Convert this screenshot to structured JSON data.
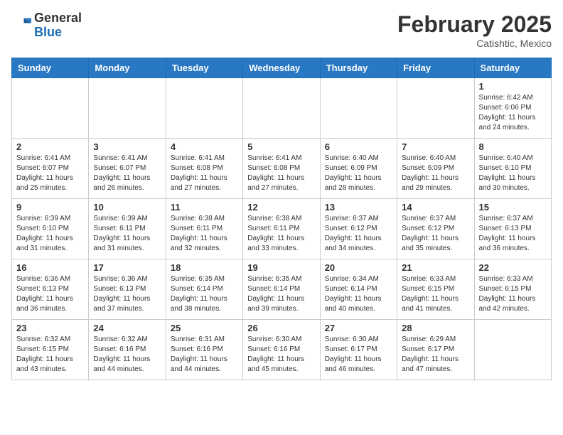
{
  "header": {
    "logo_general": "General",
    "logo_blue": "Blue",
    "month_year": "February 2025",
    "location": "Catishtic, Mexico"
  },
  "weekdays": [
    "Sunday",
    "Monday",
    "Tuesday",
    "Wednesday",
    "Thursday",
    "Friday",
    "Saturday"
  ],
  "weeks": [
    [
      {
        "day": "",
        "info": ""
      },
      {
        "day": "",
        "info": ""
      },
      {
        "day": "",
        "info": ""
      },
      {
        "day": "",
        "info": ""
      },
      {
        "day": "",
        "info": ""
      },
      {
        "day": "",
        "info": ""
      },
      {
        "day": "1",
        "info": "Sunrise: 6:42 AM\nSunset: 6:06 PM\nDaylight: 11 hours\nand 24 minutes."
      }
    ],
    [
      {
        "day": "2",
        "info": "Sunrise: 6:41 AM\nSunset: 6:07 PM\nDaylight: 11 hours\nand 25 minutes."
      },
      {
        "day": "3",
        "info": "Sunrise: 6:41 AM\nSunset: 6:07 PM\nDaylight: 11 hours\nand 26 minutes."
      },
      {
        "day": "4",
        "info": "Sunrise: 6:41 AM\nSunset: 6:08 PM\nDaylight: 11 hours\nand 27 minutes."
      },
      {
        "day": "5",
        "info": "Sunrise: 6:41 AM\nSunset: 6:08 PM\nDaylight: 11 hours\nand 27 minutes."
      },
      {
        "day": "6",
        "info": "Sunrise: 6:40 AM\nSunset: 6:09 PM\nDaylight: 11 hours\nand 28 minutes."
      },
      {
        "day": "7",
        "info": "Sunrise: 6:40 AM\nSunset: 6:09 PM\nDaylight: 11 hours\nand 29 minutes."
      },
      {
        "day": "8",
        "info": "Sunrise: 6:40 AM\nSunset: 6:10 PM\nDaylight: 11 hours\nand 30 minutes."
      }
    ],
    [
      {
        "day": "9",
        "info": "Sunrise: 6:39 AM\nSunset: 6:10 PM\nDaylight: 11 hours\nand 31 minutes."
      },
      {
        "day": "10",
        "info": "Sunrise: 6:39 AM\nSunset: 6:11 PM\nDaylight: 11 hours\nand 31 minutes."
      },
      {
        "day": "11",
        "info": "Sunrise: 6:38 AM\nSunset: 6:11 PM\nDaylight: 11 hours\nand 32 minutes."
      },
      {
        "day": "12",
        "info": "Sunrise: 6:38 AM\nSunset: 6:11 PM\nDaylight: 11 hours\nand 33 minutes."
      },
      {
        "day": "13",
        "info": "Sunrise: 6:37 AM\nSunset: 6:12 PM\nDaylight: 11 hours\nand 34 minutes."
      },
      {
        "day": "14",
        "info": "Sunrise: 6:37 AM\nSunset: 6:12 PM\nDaylight: 11 hours\nand 35 minutes."
      },
      {
        "day": "15",
        "info": "Sunrise: 6:37 AM\nSunset: 6:13 PM\nDaylight: 11 hours\nand 36 minutes."
      }
    ],
    [
      {
        "day": "16",
        "info": "Sunrise: 6:36 AM\nSunset: 6:13 PM\nDaylight: 11 hours\nand 36 minutes."
      },
      {
        "day": "17",
        "info": "Sunrise: 6:36 AM\nSunset: 6:13 PM\nDaylight: 11 hours\nand 37 minutes."
      },
      {
        "day": "18",
        "info": "Sunrise: 6:35 AM\nSunset: 6:14 PM\nDaylight: 11 hours\nand 38 minutes."
      },
      {
        "day": "19",
        "info": "Sunrise: 6:35 AM\nSunset: 6:14 PM\nDaylight: 11 hours\nand 39 minutes."
      },
      {
        "day": "20",
        "info": "Sunrise: 6:34 AM\nSunset: 6:14 PM\nDaylight: 11 hours\nand 40 minutes."
      },
      {
        "day": "21",
        "info": "Sunrise: 6:33 AM\nSunset: 6:15 PM\nDaylight: 11 hours\nand 41 minutes."
      },
      {
        "day": "22",
        "info": "Sunrise: 6:33 AM\nSunset: 6:15 PM\nDaylight: 11 hours\nand 42 minutes."
      }
    ],
    [
      {
        "day": "23",
        "info": "Sunrise: 6:32 AM\nSunset: 6:15 PM\nDaylight: 11 hours\nand 43 minutes."
      },
      {
        "day": "24",
        "info": "Sunrise: 6:32 AM\nSunset: 6:16 PM\nDaylight: 11 hours\nand 44 minutes."
      },
      {
        "day": "25",
        "info": "Sunrise: 6:31 AM\nSunset: 6:16 PM\nDaylight: 11 hours\nand 44 minutes."
      },
      {
        "day": "26",
        "info": "Sunrise: 6:30 AM\nSunset: 6:16 PM\nDaylight: 11 hours\nand 45 minutes."
      },
      {
        "day": "27",
        "info": "Sunrise: 6:30 AM\nSunset: 6:17 PM\nDaylight: 11 hours\nand 46 minutes."
      },
      {
        "day": "28",
        "info": "Sunrise: 6:29 AM\nSunset: 6:17 PM\nDaylight: 11 hours\nand 47 minutes."
      },
      {
        "day": "",
        "info": ""
      }
    ]
  ]
}
